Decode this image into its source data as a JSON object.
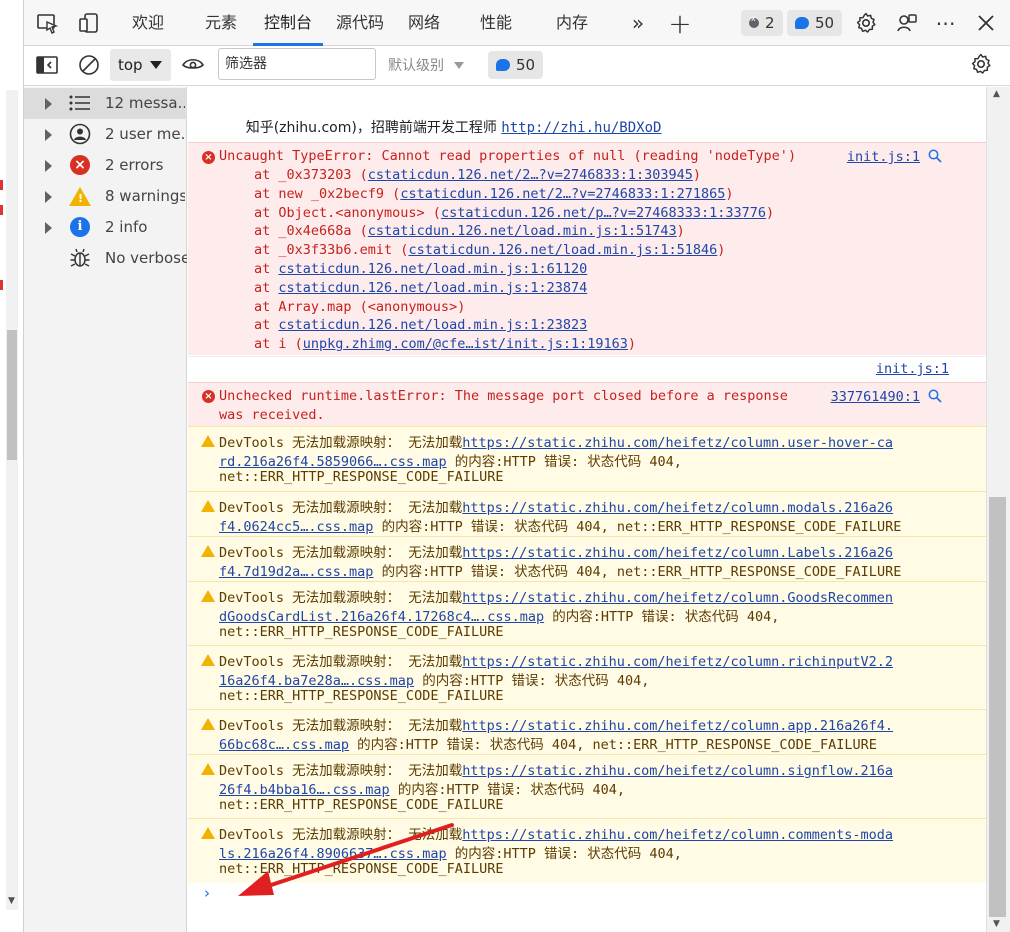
{
  "tabs": {
    "welcome": "欢迎",
    "elements": "元素",
    "console": "控制台",
    "sources": "源代码",
    "network": "网络",
    "performance": "性能",
    "memory": "内存"
  },
  "badges": {
    "errors": "2",
    "messages": "50"
  },
  "toolbar": {
    "context": "top",
    "filter_placeholder": "筛选器",
    "level": "默认级别",
    "issues_count": "50"
  },
  "sidebar": {
    "items": [
      {
        "label": "12 messa...",
        "icon": "list-icon"
      },
      {
        "label": "2 user me...",
        "icon": "user-icon"
      },
      {
        "label": "2 errors",
        "icon": "error-icon"
      },
      {
        "label": "8 warnings",
        "icon": "warning-icon"
      },
      {
        "label": "2 info",
        "icon": "info-icon"
      },
      {
        "label": "No verbose",
        "icon": "bug-icon"
      }
    ]
  },
  "console": {
    "log": {
      "text": "知乎(zhihu.com)，招聘前端开发工程师 ",
      "link": "http://zhi.hu/BDXoD"
    },
    "error1": {
      "message": "Uncaught TypeError: Cannot read properties of null (reading 'nodeType')",
      "source": "init.js:1",
      "stack": [
        {
          "fn": "at _0x373203 (",
          "link": "cstaticdun.126.net/2…?v=2746833:1:303945",
          "end": ")"
        },
        {
          "fn": "at new _0x2becf9 (",
          "link": "cstaticdun.126.net/2…?v=2746833:1:271865",
          "end": ")"
        },
        {
          "fn": "at Object.<anonymous> (",
          "link": "cstaticdun.126.net/p…?v=27468333:1:33776",
          "end": ")"
        },
        {
          "fn": "at _0x4e668a (",
          "link": "cstaticdun.126.net/load.min.js:1:51743",
          "end": ")"
        },
        {
          "fn": "at _0x3f33b6.emit (",
          "link": "cstaticdun.126.net/load.min.js:1:51846",
          "end": ")"
        },
        {
          "fn": "at ",
          "link": "cstaticdun.126.net/load.min.js:1:61120",
          "end": ""
        },
        {
          "fn": "at ",
          "link": "cstaticdun.126.net/load.min.js:1:23874",
          "end": ""
        },
        {
          "fn": "at Array.map (<anonymous>)",
          "link": "",
          "end": ""
        },
        {
          "fn": "at ",
          "link": "cstaticdun.126.net/load.min.js:1:23823",
          "end": ""
        },
        {
          "fn": "at i (",
          "link": "unpkg.zhimg.com/@cfe…ist/init.js:1:19163",
          "end": ")"
        }
      ]
    },
    "init_source": "init.js:1",
    "error2": {
      "line1": "Unchecked runtime.lastError: The message port closed before a response",
      "line2": "was received.",
      "source": "337761490:1"
    },
    "warnings": [
      {
        "prefix": "DevTools 无法加载源映射： 无法加载",
        "l1_link": "https://static.zhihu.com/heifetz/column.user-hover-ca",
        "l2_link": "rd.216a26f4.5859066….css.map",
        "l2_tail": " 的内容:HTTP 错误: 状态代码 404,",
        "l3": "net::ERR_HTTP_RESPONSE_CODE_FAILURE"
      },
      {
        "prefix": "DevTools 无法加载源映射： 无法加载",
        "l1_link": "https://static.zhihu.com/heifetz/column.modals.216a26",
        "l2_link": "f4.0624cc5….css.map",
        "l2_tail": " 的内容:HTTP 错误: 状态代码 404, net::ERR_HTTP_RESPONSE_CODE_FAILURE",
        "l3": ""
      },
      {
        "prefix": "DevTools 无法加载源映射： 无法加载",
        "l1_link": "https://static.zhihu.com/heifetz/column.Labels.216a26",
        "l2_link": "f4.7d19d2a….css.map",
        "l2_tail": " 的内容:HTTP 错误: 状态代码 404, net::ERR_HTTP_RESPONSE_CODE_FAILURE",
        "l3": ""
      },
      {
        "prefix": "DevTools 无法加载源映射： 无法加载",
        "l1_link": "https://static.zhihu.com/heifetz/column.GoodsRecommen",
        "l2_link": "dGoodsCardList.216a26f4.17268c4….css.map",
        "l2_tail": " 的内容:HTTP 错误: 状态代码 404,",
        "l3": "net::ERR_HTTP_RESPONSE_CODE_FAILURE"
      },
      {
        "prefix": "DevTools 无法加载源映射： 无法加载",
        "l1_link": "https://static.zhihu.com/heifetz/column.richinputV2.2",
        "l2_link": "16a26f4.ba7e28a….css.map",
        "l2_tail": " 的内容:HTTP 错误: 状态代码 404,",
        "l3": "net::ERR_HTTP_RESPONSE_CODE_FAILURE"
      },
      {
        "prefix": "DevTools 无法加载源映射： 无法加载",
        "l1_link": "https://static.zhihu.com/heifetz/column.app.216a26f4.",
        "l2_link": "66bc68c….css.map",
        "l2_tail": " 的内容:HTTP 错误: 状态代码 404, net::ERR_HTTP_RESPONSE_CODE_FAILURE",
        "l3": ""
      },
      {
        "prefix": "DevTools 无法加载源映射： 无法加载",
        "l1_link": "https://static.zhihu.com/heifetz/column.signflow.216a",
        "l2_link": "26f4.b4bba16….css.map",
        "l2_tail": " 的内容:HTTP 错误: 状态代码 404,",
        "l3": "net::ERR_HTTP_RESPONSE_CODE_FAILURE"
      },
      {
        "prefix": "DevTools 无法加载源映射： 无法加载",
        "l1_link": "https://static.zhihu.com/heifetz/column.comments-moda",
        "l2_link": "ls.216a26f4.8906637….css.map",
        "l2_tail": " 的内容:HTTP 错误: 状态代码 404,",
        "l3": "net::ERR_HTTP_RESPONSE_CODE_FAILURE"
      }
    ],
    "prompt": "›"
  },
  "colors": {
    "accent": "#1a73e8",
    "error": "#d93025",
    "warning": "#f2b200",
    "annotation": "#e02020"
  }
}
